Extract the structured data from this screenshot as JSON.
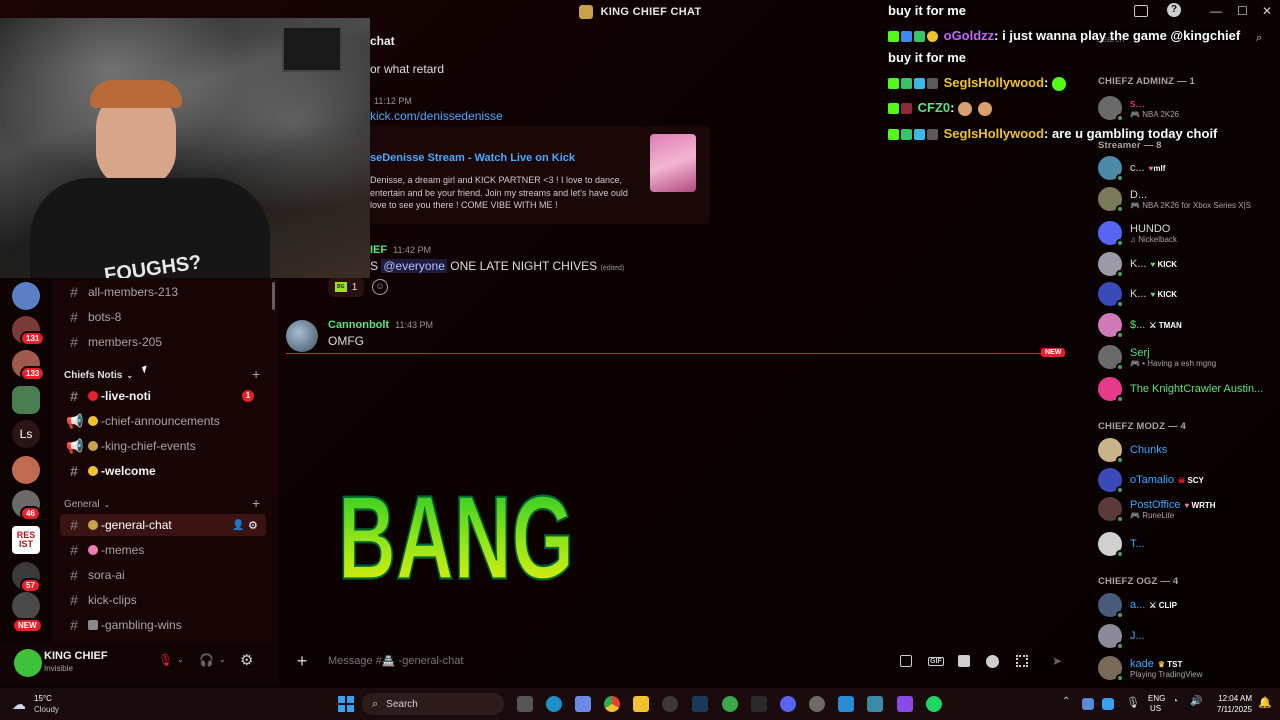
{
  "window": {
    "title": "KING CHIEF CHAT"
  },
  "overlay": {
    "lines": [
      {
        "user": "",
        "text": "buy it for me"
      },
      {
        "user": "oGoldzz",
        "text": ": i just wanna play the game @kingchief"
      },
      {
        "user": "",
        "text": "buy it for me"
      },
      {
        "user": "SegIsHollywood",
        "text": ":"
      },
      {
        "user": "CFZ0",
        "text": ":"
      },
      {
        "user": "SegIsHollywood",
        "text": ": are u gambling today choif"
      }
    ]
  },
  "rail": {
    "badges": [
      "131",
      "133",
      "46",
      "57"
    ],
    "text_server": "Ls",
    "resist": "RES\nIST",
    "new_label": "NEW"
  },
  "channels": {
    "top": [
      "all-members-213",
      "bots-8",
      "members-205"
    ],
    "cat1": "Chiefs Notis",
    "cat1_items": [
      {
        "name": "-live-noti",
        "badge": "1"
      },
      {
        "name": "-chief-announcements"
      },
      {
        "name": "-king-chief-events"
      },
      {
        "name": "-welcome"
      }
    ],
    "cat2": "General",
    "cat2_items": [
      "-general-chat",
      "-memes",
      "sora-ai",
      "kick-clips",
      "-gambling-wins"
    ]
  },
  "user": {
    "name": "KING CHIEF",
    "status": "Invisible"
  },
  "chat": {
    "header": "chat",
    "msg1": "or what retard",
    "ts1": "11:12 PM",
    "link": "kick.com/denissedenisse",
    "embed_title": "seDenisse Stream - Watch Live on Kick",
    "embed_desc": "Denisse, a dream girl and KICK PARTNER <3 ! I love to dance, entertain and be your friend. Join my streams and let's have ould love to see you there ! COME VIBE WITH ME !",
    "author2": "IEF",
    "ts2": "11:42 PM",
    "msg2_prefix": "S",
    "mention": "@everyone",
    "msg2": "ONE LATE NIGHT CHIVES",
    "edited": "(edited)",
    "reaction_count": "1",
    "author3": "Cannonbolt",
    "ts3": "11:43 PM",
    "msg3": "OMFG",
    "new_label": "NEW",
    "bang": "BANG",
    "placeholder": "Message #🏯 -general-chat"
  },
  "members": {
    "search": "Search",
    "cat_admin": "CHIEFZ ADMINZ — 1",
    "admin": [
      {
        "name": "s...",
        "sub": "NBA 2K26"
      }
    ],
    "cat_streamer": "Streamer — 8",
    "streamers": [
      {
        "name": "c...",
        "tag": "mlf",
        "sub": ""
      },
      {
        "name": "D...",
        "tag": "",
        "sub": "NBA 2K26 for Xbox Series X|S"
      },
      {
        "name": "HUNDO",
        "tag": "",
        "sub": "Nickelback"
      },
      {
        "name": "K...",
        "tag": "KICK",
        "sub": ""
      },
      {
        "name": "K...",
        "tag": "KICK",
        "sub": ""
      },
      {
        "name": "$...",
        "tag": "TMAN",
        "sub": ""
      },
      {
        "name": "Serj",
        "tag": "",
        "sub": "• Having a esh mgng"
      },
      {
        "name": "The KnightCrawler Austin...",
        "tag": "",
        "sub": ""
      }
    ],
    "cat_modz": "CHIEFZ MODZ — 4",
    "modz": [
      {
        "name": "Chunks",
        "tag": "",
        "sub": ""
      },
      {
        "name": "oTamalio",
        "tag": "SCY",
        "sub": ""
      },
      {
        "name": "PostOffice",
        "tag": "WRTH",
        "sub": "RuneLite"
      },
      {
        "name": "T...",
        "tag": "",
        "sub": ""
      }
    ],
    "cat_ogz": "CHIEFZ OGZ — 4",
    "ogz": [
      {
        "name": "a...",
        "tag": "CLIP",
        "sub": ""
      },
      {
        "name": "J...",
        "tag": "",
        "sub": ""
      },
      {
        "name": "kade",
        "tag": "TST",
        "sub": "Playing TradingView"
      }
    ]
  },
  "taskbar": {
    "temp": "15°C",
    "weather": "Cloudy",
    "search": "Search",
    "lang1": "ENG",
    "lang2": "US",
    "time": "12:04 AM",
    "date": "7/11/2025"
  },
  "colors": {
    "accent": "#5ee37a",
    "danger": "#e8202a",
    "bg": "#0b0202"
  }
}
